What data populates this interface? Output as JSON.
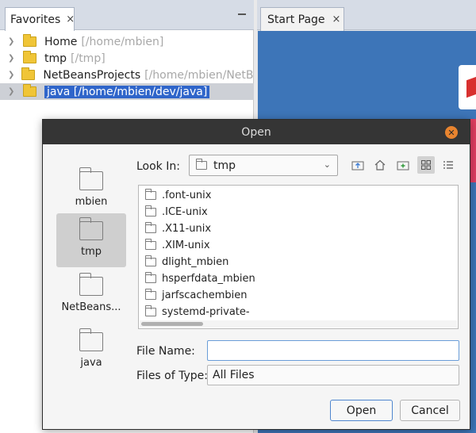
{
  "favorites": {
    "tab_label": "Favorites",
    "tab_close": "×",
    "items": [
      {
        "name": "Home",
        "path": "[/home/mbien]"
      },
      {
        "name": "tmp",
        "path": "[/tmp]"
      },
      {
        "name": "NetBeansProjects",
        "path": "[/home/mbien/NetBeansProjects]"
      },
      {
        "name": "java",
        "path": "[/home/mbien/dev/java]"
      }
    ],
    "selected_index": 3
  },
  "start_page": {
    "tab_label": "Start Page",
    "tab_close": "×"
  },
  "dialog": {
    "title": "Open",
    "close_glyph": "✕",
    "places": [
      {
        "label": "mbien"
      },
      {
        "label": "tmp"
      },
      {
        "label": "NetBeans..."
      },
      {
        "label": "java"
      }
    ],
    "active_place": "tmp",
    "look_in_label": "Look In:",
    "look_in_value": "tmp",
    "files": [
      ".font-unix",
      ".ICE-unix",
      ".X11-unix",
      ".XIM-unix",
      "dlight_mbien",
      "hsperfdata_mbien",
      "jarfscachembien",
      "systemd-private-"
    ],
    "file_name_label": "File Name:",
    "file_name_value": "",
    "files_of_type_label": "Files of Type:",
    "files_of_type_value": "All Files",
    "open_button": "Open",
    "cancel_button": "Cancel"
  },
  "colors": {
    "selection": "#2f65ca",
    "title_bar": "#353535",
    "close_button": "#e8842f",
    "folder_yellow": "#f0c537",
    "start_page_bg": "#3d75b8"
  }
}
